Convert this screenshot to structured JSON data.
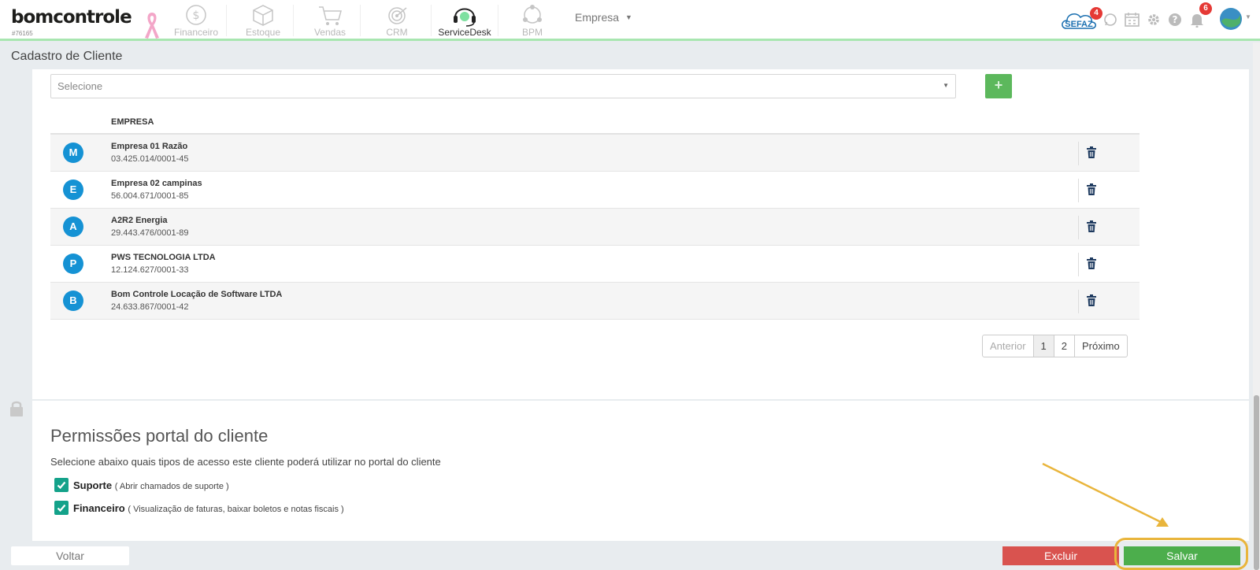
{
  "header": {
    "logo": "bomcontrole",
    "account_id": "#76165",
    "modules": [
      {
        "label": "Financeiro",
        "icon": "dollar-circle-icon"
      },
      {
        "label": "Estoque",
        "icon": "box-icon"
      },
      {
        "label": "Vendas",
        "icon": "cart-icon"
      },
      {
        "label": "CRM",
        "icon": "target-icon"
      },
      {
        "label": "ServiceDesk",
        "icon": "headset-icon"
      },
      {
        "label": "BPM",
        "icon": "process-icon"
      }
    ],
    "company_menu": "Empresa",
    "sefaz_label": "SEFAZ",
    "sefaz_badge": "4",
    "notifications_badge": "6"
  },
  "page": {
    "title": "Cadastro de Cliente"
  },
  "company_select": {
    "placeholder": "Selecione",
    "add_label": "+"
  },
  "table": {
    "header": "EMPRESA",
    "rows": [
      {
        "initial": "M",
        "name": "Empresa 01 Razão",
        "doc": "03.425.014/0001-45"
      },
      {
        "initial": "E",
        "name": "Empresa 02 campinas",
        "doc": "56.004.671/0001-85"
      },
      {
        "initial": "A",
        "name": "A2R2 Energia",
        "doc": "29.443.476/0001-89"
      },
      {
        "initial": "P",
        "name": "PWS TECNOLOGIA LTDA",
        "doc": "12.124.627/0001-33"
      },
      {
        "initial": "B",
        "name": "Bom Controle Locação de Software LTDA",
        "doc": "24.633.867/0001-42"
      }
    ]
  },
  "pagination": {
    "prev": "Anterior",
    "pages": [
      "1",
      "2"
    ],
    "current": "1",
    "next": "Próximo"
  },
  "permissions": {
    "title": "Permissões portal do cliente",
    "description": "Selecione abaixo quais tipos de acesso este cliente poderá utilizar no portal do cliente",
    "options": [
      {
        "label": "Suporte",
        "detail": "( Abrir chamados de suporte )",
        "checked": true
      },
      {
        "label": "Financeiro",
        "detail": "( Visualização de faturas, baixar boletos e notas fiscais )",
        "checked": true
      }
    ]
  },
  "footer": {
    "back": "Voltar",
    "delete": "Excluir",
    "save": "Salvar"
  },
  "colors": {
    "primary_green": "#4cae4c",
    "danger_red": "#d9534f",
    "avatar_blue": "#1592d4",
    "checkbox_teal": "#14a28a",
    "highlight_orange": "#e9b53c"
  }
}
